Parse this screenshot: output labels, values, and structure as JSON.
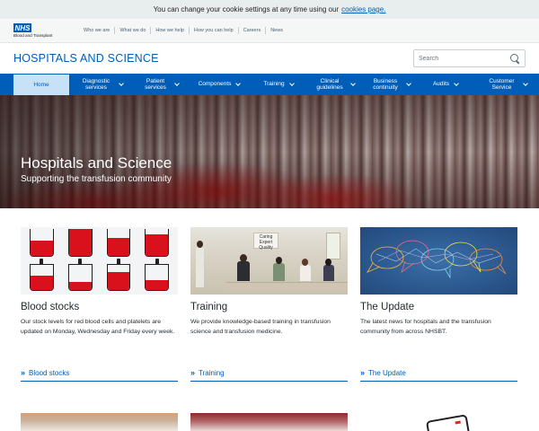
{
  "cookie_bar": {
    "text": "You can change your cookie settings at any time using our",
    "link": "cookies page."
  },
  "utility": {
    "logo_badge": "NHS",
    "logo_text": "Blood and Transplant",
    "links": [
      "Who we are",
      "What we do",
      "How we help",
      "How you can help",
      "Careers",
      "News"
    ]
  },
  "header": {
    "title": "HOSPITALS AND SCIENCE",
    "search_placeholder": "Search"
  },
  "nav": {
    "items": [
      {
        "label": "Home",
        "active": true
      },
      {
        "label": "Diagnostic services"
      },
      {
        "label": "Patient services"
      },
      {
        "label": "Components"
      },
      {
        "label": "Training"
      },
      {
        "label": "Clinical guidelines"
      },
      {
        "label": "Business continuity"
      },
      {
        "label": "Audits"
      },
      {
        "label": "Customer Service"
      }
    ]
  },
  "hero": {
    "title": "Hospitals and Science",
    "subtitle": "Supporting the transfusion community"
  },
  "cards": [
    {
      "title": "Blood stocks",
      "description": "Our stock levels for red blood cells and platelets are updated on Monday, Wednesday and Friday every week.",
      "link": "Blood stocks"
    },
    {
      "title": "Training",
      "description": "We provide knowledge-based training in transfusion science and transfusion medicine.",
      "link": "Training",
      "board_text": "Caring Expert Quality"
    },
    {
      "title": "The Update",
      "description": "The latest news for hospitals and the transfusion community from across NHSBT.",
      "link": "The Update"
    }
  ],
  "colors": {
    "brand_blue": "#005eb8",
    "nav_active_bg": "#c7e2f6",
    "blood_red": "#d9111c"
  }
}
